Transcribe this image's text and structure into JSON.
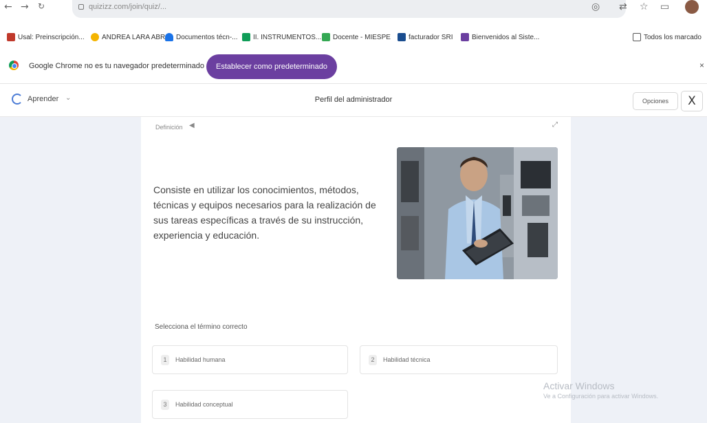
{
  "browser": {
    "url": "quizizz.com/join/quiz/...",
    "bookmarks": [
      {
        "label": "Usal: Preinscripción...",
        "color": "#c0392b"
      },
      {
        "label": "ANDREA LARA ABR...",
        "color": "#f4b400"
      },
      {
        "label": "Documentos técn-...",
        "color": "#1a73e8"
      },
      {
        "label": "II. INSTRUMENTOS...",
        "color": "#0f9d58"
      },
      {
        "label": "Docente - MIESPE",
        "color": "#34a853"
      },
      {
        "label": "facturador SRI",
        "color": "#1a4d8f"
      },
      {
        "label": "Bienvenidos al Siste...",
        "color": "#6b3fa0"
      }
    ],
    "all_bookmarks_label": "Todos los marcado",
    "infobar": {
      "message": "Google Chrome no es tu navegador predeterminado",
      "button_label": "Establecer como predeterminado"
    }
  },
  "quiz": {
    "mode_label": "Aprender",
    "title": "Perfil del administrador",
    "options_label": "Opciones",
    "close_label": "X",
    "definition_label": "Definición",
    "definition_text": "Consiste en utilizar los conocimientos, métodos, técnicas y equipos necesarios para la realización de sus tareas específicas a través de su instrucción, experiencia y educación.",
    "prompt": "Selecciona el término correcto",
    "answers": [
      {
        "num": "1",
        "text": "Habilidad humana"
      },
      {
        "num": "2",
        "text": "Habilidad técnica"
      },
      {
        "num": "3",
        "text": "Habilidad conceptual"
      }
    ]
  },
  "watermark": {
    "line1": "Activar Windows",
    "line2": "Ve a Configuración para activar Windows."
  },
  "colors": {
    "accent_purple": "#6b3fa0",
    "stage_bg": "#eef1f7"
  }
}
